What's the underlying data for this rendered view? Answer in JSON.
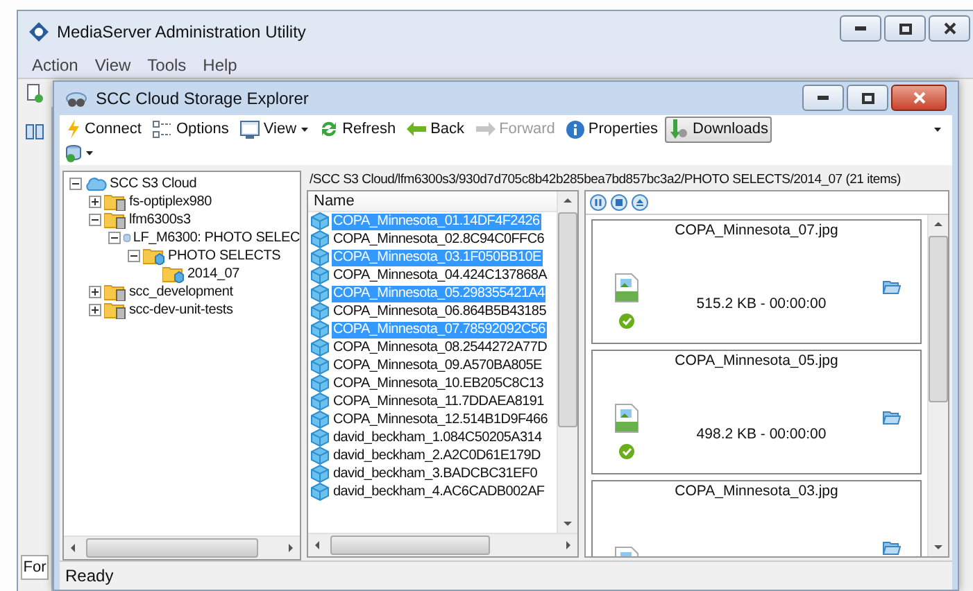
{
  "main_window": {
    "title": "MediaServer Administration Utility",
    "menu": [
      "Action",
      "View",
      "Tools",
      "Help"
    ],
    "footer_tab": "For"
  },
  "explorer": {
    "title": "SCC Cloud Storage Explorer",
    "toolbar": [
      {
        "label": "Connect",
        "dropdown": false,
        "disabled": false,
        "selected": false
      },
      {
        "label": "Options",
        "dropdown": false,
        "disabled": false,
        "selected": false
      },
      {
        "label": "View",
        "dropdown": true,
        "disabled": false,
        "selected": false
      },
      {
        "label": "Refresh",
        "dropdown": false,
        "disabled": false,
        "selected": false
      },
      {
        "label": "Back",
        "dropdown": false,
        "disabled": false,
        "selected": false
      },
      {
        "label": "Forward",
        "dropdown": false,
        "disabled": true,
        "selected": false
      },
      {
        "label": "Properties",
        "dropdown": false,
        "disabled": false,
        "selected": false
      },
      {
        "label": "Downloads",
        "dropdown": false,
        "disabled": false,
        "selected": true
      }
    ],
    "tree": [
      {
        "label": "SCC S3 Cloud",
        "kind": "cloud",
        "expanded": true,
        "children": [
          {
            "label": "fs-optiplex980",
            "kind": "server",
            "expanded": false
          },
          {
            "label": "lfm6300s3",
            "kind": "server",
            "expanded": true,
            "children": [
              {
                "label": "LF_M6300: PHOTO SELEC",
                "kind": "database",
                "expanded": true,
                "children": [
                  {
                    "label": "PHOTO SELECTS",
                    "kind": "folder",
                    "expanded": true,
                    "children": [
                      {
                        "label": "2014_07",
                        "kind": "folder"
                      }
                    ]
                  }
                ]
              }
            ]
          },
          {
            "label": "scc_development",
            "kind": "server",
            "expanded": false
          },
          {
            "label": "scc-dev-unit-tests",
            "kind": "server",
            "expanded": false
          }
        ]
      }
    ],
    "path": "/SCC S3 Cloud/lfm6300s3/930d7d705c8b42b285bea7bd857bc3a2/PHOTO SELECTS/2014_07 (21 items)",
    "list_header": "Name",
    "files": [
      {
        "name": "COPA_Minnesota_01.14DF4F2426",
        "selected": true
      },
      {
        "name": "COPA_Minnesota_02.8C94C0FFC6",
        "selected": false
      },
      {
        "name": "COPA_Minnesota_03.1F050BB10E",
        "selected": true
      },
      {
        "name": "COPA_Minnesota_04.424C137868A",
        "selected": false
      },
      {
        "name": "COPA_Minnesota_05.298355421A4",
        "selected": true
      },
      {
        "name": "COPA_Minnesota_06.864B5B43185",
        "selected": false
      },
      {
        "name": "COPA_Minnesota_07.78592092C56",
        "selected": true
      },
      {
        "name": "COPA_Minnesota_08.2544272A77D",
        "selected": false
      },
      {
        "name": "COPA_Minnesota_09.A570BA805E",
        "selected": false
      },
      {
        "name": "COPA_Minnesota_10.EB205C8C13",
        "selected": false
      },
      {
        "name": "COPA_Minnesota_11.7DDAEA8191",
        "selected": false
      },
      {
        "name": "COPA_Minnesota_12.514B1D9F466",
        "selected": false
      },
      {
        "name": "david_beckham_1.084C50205A314",
        "selected": false
      },
      {
        "name": "david_beckham_2.A2C0D61E179D",
        "selected": false
      },
      {
        "name": "david_beckham_3.BADCBC31EF0",
        "selected": false
      },
      {
        "name": "david_beckham_4.AC6CADB002AF",
        "selected": false
      }
    ],
    "downloads": [
      {
        "name": "COPA_Minnesota_07.jpg",
        "size": "515.2 KB - 00:00:00",
        "done": true
      },
      {
        "name": "COPA_Minnesota_05.jpg",
        "size": "498.2 KB - 00:00:00",
        "done": true
      },
      {
        "name": "COPA_Minnesota_03.jpg",
        "done": false
      }
    ],
    "status": "Ready"
  }
}
